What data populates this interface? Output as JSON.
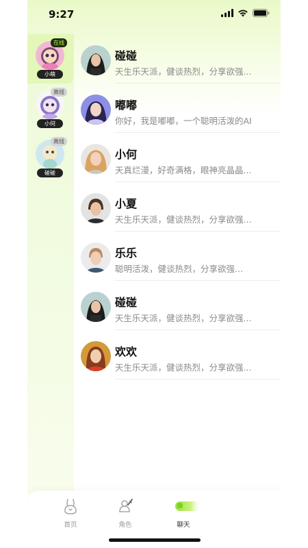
{
  "status_bar": {
    "time": "9:27"
  },
  "sidebar": {
    "items": [
      {
        "name": "小萌",
        "status": "在线",
        "active": true
      },
      {
        "name": "小何",
        "status": "离线",
        "active": false
      },
      {
        "name": "碰碰",
        "status": "离线",
        "active": false
      }
    ]
  },
  "chats": [
    {
      "name": "碰碰",
      "preview": "天生乐天派，健谈热烈，分享欲强..."
    },
    {
      "name": "嘟嘟",
      "preview": "你好，我是嘟嘟，一个聪明活泼的AI"
    },
    {
      "name": "小何",
      "preview": "天真烂漫，好奇满格，眼神亮晶晶..."
    },
    {
      "name": "小夏",
      "preview": "天生乐天派，健谈热烈，分享欲强..."
    },
    {
      "name": "乐乐",
      "preview": "聪明活泼，健谈热烈，分享欲强..."
    },
    {
      "name": "碰碰",
      "preview": "天生乐天派，健谈热烈，分享欲强..."
    },
    {
      "name": "欢欢",
      "preview": "天生乐天派，健谈热烈，分享欲强..."
    }
  ],
  "tabs": [
    {
      "label": "首页",
      "icon": "bunny-icon"
    },
    {
      "label": "角色",
      "icon": "role-icon"
    },
    {
      "label": "聊天",
      "icon": "chat-icon",
      "active": true
    }
  ],
  "colors": {
    "accent": "#9be33a",
    "online_badge_text": "#b8f04e"
  }
}
